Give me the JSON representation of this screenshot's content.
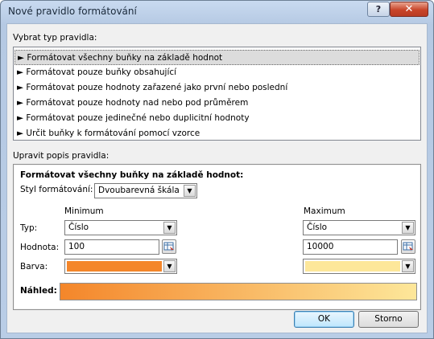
{
  "window": {
    "title": "Nové pravidlo formátování",
    "help_glyph": "?",
    "close_glyph": "✕"
  },
  "rule_type": {
    "label": "Vybrat typ pravidla:",
    "arrow": "►",
    "items": [
      "Formátovat všechny buňky na základě hodnot",
      "Formátovat pouze buňky obsahující",
      "Formátovat pouze hodnoty zařazené jako první nebo poslední",
      "Formátovat pouze hodnoty nad nebo pod průměrem",
      "Formátovat pouze jedinečné nebo duplicitní hodnoty",
      "Určit buňky k formátování pomocí vzorce"
    ],
    "selected_index": 0
  },
  "description": {
    "label": "Upravit popis pravidla:",
    "heading": "Formátovat všechny buňky na základě hodnot:",
    "style_label": "Styl formátování:",
    "style_value": "Dvoubarevná škála",
    "min_label": "Minimum",
    "max_label": "Maximum",
    "type_label": "Typ:",
    "value_label": "Hodnota:",
    "color_label": "Barva:",
    "min": {
      "type": "Číslo",
      "value": "100",
      "color": "#f4862a"
    },
    "max": {
      "type": "Číslo",
      "value": "10000",
      "color": "#fde79a"
    },
    "preview_label": "Náhled:"
  },
  "buttons": {
    "ok": "OK",
    "cancel": "Storno"
  },
  "colors": {
    "selection": "#dcdcdc",
    "min_color": "#f4862a",
    "max_color": "#fde79a"
  }
}
